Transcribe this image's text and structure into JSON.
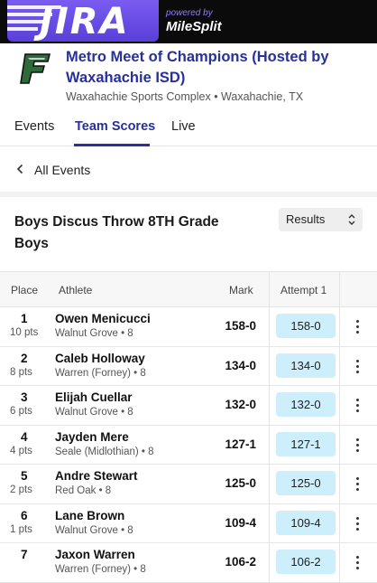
{
  "banner": {
    "logo_text": "JIRA",
    "powered_by": "powered by",
    "brand": "MileSplit"
  },
  "meet": {
    "title": "Metro Meet of Champions (Hosted by Waxahachie ISD)",
    "location": "Waxahachie Sports Complex • Waxahachie, TX",
    "logo_icon": "waxahachie-f-logo",
    "title_color": "#27309b"
  },
  "tabs": [
    {
      "label": "Events"
    },
    {
      "label": "Team Scores"
    },
    {
      "label": "Live"
    }
  ],
  "back": {
    "label": "All Events",
    "icon": "chevron-left-icon"
  },
  "event": {
    "title": "Boys Discus Throw 8TH Grade Boys",
    "view_select": "Results"
  },
  "table": {
    "headers": {
      "place": "Place",
      "athlete": "Athlete",
      "mark": "Mark",
      "attempt": "Attempt 1"
    },
    "rows": [
      {
        "place": "1",
        "pts": "10 pts",
        "name": "Owen Menicucci",
        "team": "Walnut Grove • 8",
        "mark": "158-0",
        "attempt": "158-0"
      },
      {
        "place": "2",
        "pts": "8 pts",
        "name": "Caleb Holloway",
        "team": "Warren (Forney) • 8",
        "mark": "134-0",
        "attempt": "134-0"
      },
      {
        "place": "3",
        "pts": "6 pts",
        "name": "Elijah Cuellar",
        "team": "Walnut Grove • 8",
        "mark": "132-0",
        "attempt": "132-0"
      },
      {
        "place": "4",
        "pts": "4 pts",
        "name": "Jayden Mere",
        "team": "Seale (Midlothian) • 8",
        "mark": "127-1",
        "attempt": "127-1"
      },
      {
        "place": "5",
        "pts": "2 pts",
        "name": "Andre Stewart",
        "team": "Red Oak • 8",
        "mark": "125-0",
        "attempt": "125-0"
      },
      {
        "place": "6",
        "pts": "1 pts",
        "name": "Lane Brown",
        "team": "Walnut Grove • 8",
        "mark": "109-4",
        "attempt": "109-4"
      },
      {
        "place": "7",
        "pts": "",
        "name": "Jaxon Warren",
        "team": "Warren (Forney) • 8",
        "mark": "106-2",
        "attempt": "106-2"
      }
    ]
  },
  "colors": {
    "accent": "#27309b",
    "attempt_chip": "#cdeefb",
    "banner_purple": "#6a4ee6"
  }
}
